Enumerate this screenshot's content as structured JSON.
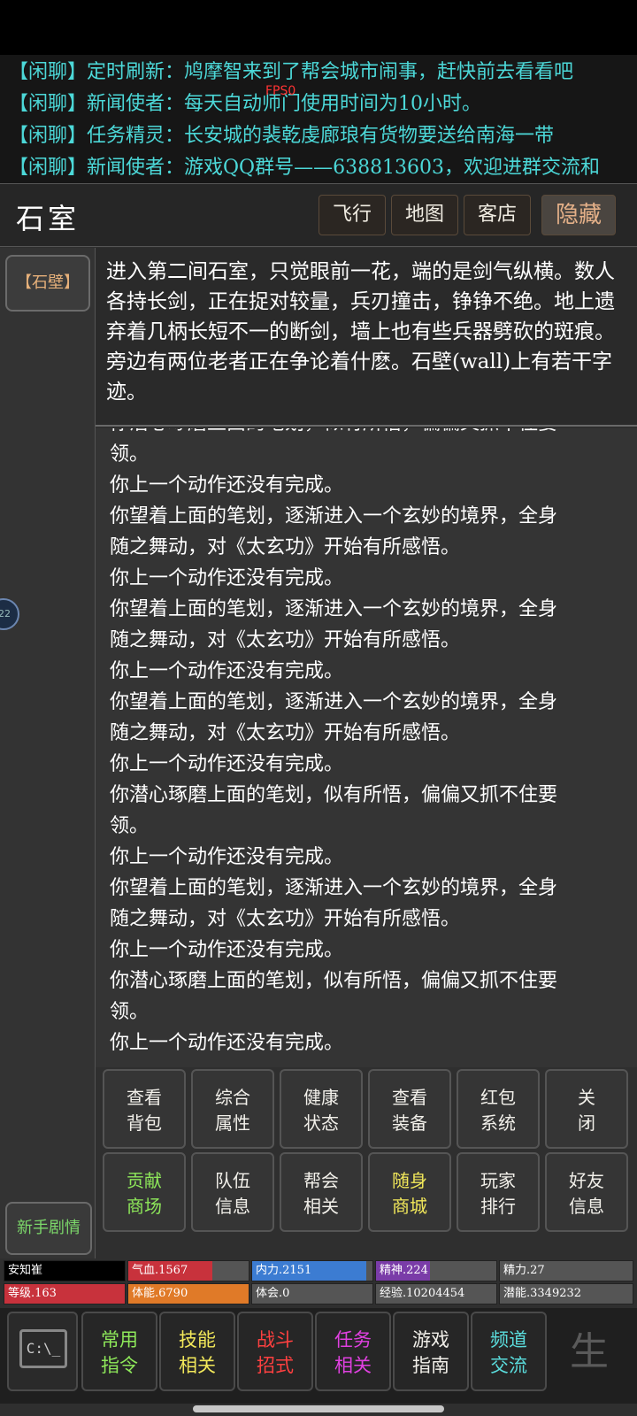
{
  "chat": {
    "lines": [
      "【闲聊】定时刷新：鸠摩智来到了帮会城市闹事，赶快前去看看吧",
      "【闲聊】新闻使者：每天自动师门使用时间为10小时。",
      "【闲聊】任务精灵：长安城的裴乾虔廊琅有货物要送给南海一带",
      "【闲聊】新闻使者：游戏QQ群号——638813603，欢迎进群交流和"
    ],
    "fps": "FPS0"
  },
  "header": {
    "room": "石室",
    "buttons": [
      "飞行",
      "地图",
      "客店",
      "隐藏"
    ]
  },
  "left": {
    "wall_btn": "【石壁】",
    "side_badge": "22",
    "newbie_btn": "新手剧情"
  },
  "desc": "进入第二间石室，只觉眼前一花，端的是剑气纵横。数人各持长剑，正在捉对较量，兵刃撞击，铮铮不绝。地上遗弃着几柄长短不一的断剑，墙上也有些兵器劈砍的斑痕。旁边有两位老者正在争论着什麽。石壁(wall)上有若干字迹。",
  "log": [
    "你潜心琢磨上面的笔划，似有所悟，偏偏又抓不住要",
    "领。",
    "你上一个动作还没有完成。",
    "你望着上面的笔划，逐渐进入一个玄妙的境界，全身",
    "随之舞动，对《太玄功》开始有所感悟。",
    "你上一个动作还没有完成。",
    "你望着上面的笔划，逐渐进入一个玄妙的境界，全身",
    "随之舞动，对《太玄功》开始有所感悟。",
    "你上一个动作还没有完成。",
    "你望着上面的笔划，逐渐进入一个玄妙的境界，全身",
    "随之舞动，对《太玄功》开始有所感悟。",
    "你上一个动作还没有完成。",
    "你潜心琢磨上面的笔划，似有所悟，偏偏又抓不住要",
    "领。",
    "你上一个动作还没有完成。",
    "你望着上面的笔划，逐渐进入一个玄妙的境界，全身",
    "随之舞动，对《太玄功》开始有所感悟。",
    "你上一个动作还没有完成。",
    "你潜心琢磨上面的笔划，似有所悟，偏偏又抓不住要",
    "领。",
    "你上一个动作还没有完成。"
  ],
  "grid": {
    "row1": [
      {
        "l1": "查看",
        "l2": "背包"
      },
      {
        "l1": "综合",
        "l2": "属性"
      },
      {
        "l1": "健康",
        "l2": "状态"
      },
      {
        "l1": "查看",
        "l2": "装备"
      },
      {
        "l1": "红包",
        "l2": "系统"
      },
      {
        "l1": "关",
        "l2": "闭"
      }
    ],
    "row2": [
      {
        "l1": "贡献",
        "l2": "商场"
      },
      {
        "l1": "队伍",
        "l2": "信息"
      },
      {
        "l1": "帮会",
        "l2": "相关"
      },
      {
        "l1": "随身",
        "l2": "商城"
      },
      {
        "l1": "玩家",
        "l2": "排行"
      },
      {
        "l1": "好友",
        "l2": "信息"
      }
    ]
  },
  "stats": {
    "name": "安知崔",
    "hp": "气血.1567",
    "mp": "内力.2151",
    "spirit": "精神.224",
    "energy": "精力.27",
    "level": "等级.163",
    "stamina": "体能.6790",
    "insight": "体会.0",
    "exp": "经验.10204454",
    "potential": "潜能.3349232",
    "hp_fill": 0.7,
    "mp_fill": 0.95,
    "spirit_fill": 0.45,
    "level_fill": 1.0,
    "stamina_fill": 1.0,
    "colors": {
      "hp": "#c8323c",
      "mp": "#3c7cd2",
      "spirit": "#7a3ca8",
      "level": "#c8323c",
      "stamina": "#e07a28"
    }
  },
  "bottom": {
    "cmd_icon": "C:\\_",
    "buttons": [
      {
        "l1": "常用",
        "l2": "指令",
        "color": "#8ee85a"
      },
      {
        "l1": "技能",
        "l2": "相关",
        "color": "#f2e85a"
      },
      {
        "l1": "战斗",
        "l2": "招式",
        "color": "#ff4040"
      },
      {
        "l1": "任务",
        "l2": "相关",
        "color": "#e040e0"
      },
      {
        "l1": "游戏",
        "l2": "指南",
        "color": "#f2f0ea"
      },
      {
        "l1": "频道",
        "l2": "交流",
        "color": "#5adcdc"
      }
    ],
    "sheng": "生"
  }
}
